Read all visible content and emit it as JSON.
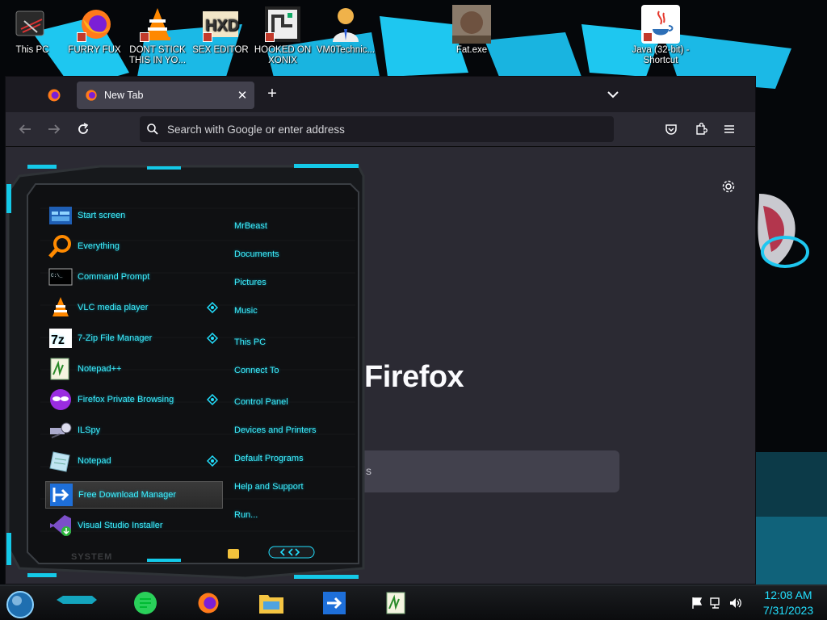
{
  "desktop": {
    "icons": [
      {
        "label": "This PC",
        "icon": "computer-icon"
      },
      {
        "label": "FURRY FUX",
        "icon": "firefox-icon"
      },
      {
        "label": "DONT STICK THIS IN YO...",
        "icon": "vlc-icon"
      },
      {
        "label": "SEX EDITOR",
        "icon": "hxd-editor-icon"
      },
      {
        "label": "HOOKED ON XONIX",
        "icon": "game-icon"
      },
      {
        "label": "VM0Technic...",
        "icon": "doctor-icon"
      },
      {
        "label": "Fat.exe",
        "icon": "photo-icon"
      },
      {
        "label": "Java (32-bit) - Shortcut",
        "icon": "java-icon"
      }
    ]
  },
  "browser": {
    "pinned_tab_icon": "firefox-icon",
    "active_tab": {
      "title": "New Tab"
    },
    "new_tab_label": "+",
    "url_placeholder": "Search with Google or enter address",
    "brand": "Firefox",
    "content_search_text": "s"
  },
  "start_menu": {
    "programs": [
      {
        "label": "Start screen",
        "icon": "start-screen-icon",
        "submenu": false
      },
      {
        "label": "Everything",
        "icon": "magnifier-icon",
        "submenu": false
      },
      {
        "label": "Command Prompt",
        "icon": "terminal-icon",
        "submenu": false
      },
      {
        "label": "VLC media player",
        "icon": "vlc-icon",
        "submenu": true
      },
      {
        "label": "7-Zip File Manager",
        "icon": "7zip-icon",
        "submenu": true
      },
      {
        "label": "Notepad++",
        "icon": "notepadpp-icon",
        "submenu": false
      },
      {
        "label": "Firefox Private Browsing",
        "icon": "private-browsing-icon",
        "submenu": true
      },
      {
        "label": "ILSpy",
        "icon": "ilspy-icon",
        "submenu": false
      },
      {
        "label": "Notepad",
        "icon": "notepad-icon",
        "submenu": true
      },
      {
        "label": "Free Download Manager",
        "icon": "download-manager-icon",
        "submenu": false,
        "selected": true
      },
      {
        "label": "Visual Studio Installer",
        "icon": "visual-studio-icon",
        "submenu": false
      }
    ],
    "places": [
      "MrBeast",
      "Documents",
      "Pictures",
      "Music",
      "This PC",
      "Connect To",
      "Control Panel",
      "Devices and Printers",
      "Default Programs",
      "Help and Support",
      "Run..."
    ],
    "system_label": "SYSTEM"
  },
  "taskbar": {
    "apps": [
      "notes-app-icon",
      "firefox-icon",
      "file-explorer-icon",
      "download-manager-icon",
      "notepadpp-icon"
    ],
    "clock_time": "12:08 AM",
    "clock_date": "7/31/2023"
  },
  "colors": {
    "accent": "#22e0ff",
    "menu_text": "#3ff0ff",
    "browser_bg": "#2b2a33"
  }
}
